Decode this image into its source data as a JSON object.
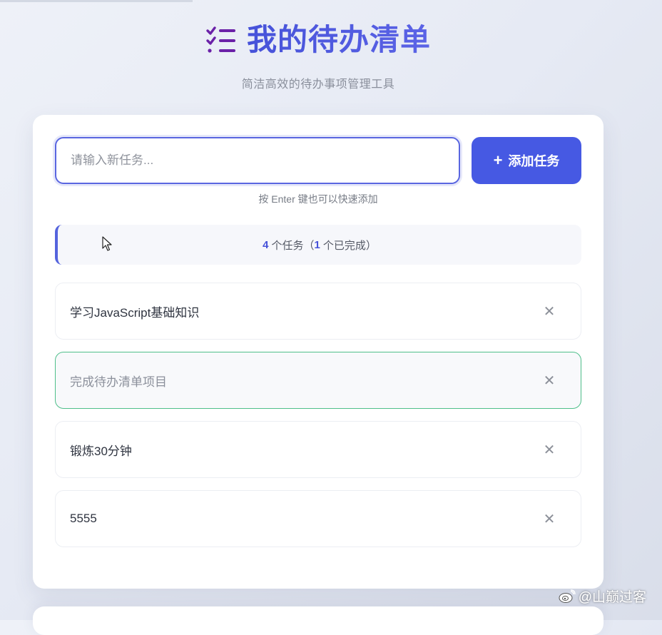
{
  "header": {
    "title": "我的待办清单",
    "subtitle": "简洁高效的待办事项管理工具",
    "icon": "checklist-icon"
  },
  "input": {
    "placeholder": "请输入新任务...",
    "value": "",
    "add_label": "添加任务",
    "add_icon": "plus-icon",
    "hint": "按 Enter 键也可以快速添加"
  },
  "stats": {
    "total": "4",
    "total_label": "个任务（",
    "done": "1",
    "done_label": "个已完成）"
  },
  "tasks": [
    {
      "text": "学习JavaScript基础知识",
      "completed": false
    },
    {
      "text": "完成待办清单项目",
      "completed": true
    },
    {
      "text": "锻炼30分钟",
      "completed": false
    },
    {
      "text": "5555",
      "completed": false
    }
  ],
  "delete_icon": "close-icon",
  "watermark": "@山巅过客",
  "colors": {
    "accent": "#4659e3",
    "title": "#4a57db",
    "icon_purple": "#6b21a8",
    "completed_border": "#4fbf8a"
  }
}
